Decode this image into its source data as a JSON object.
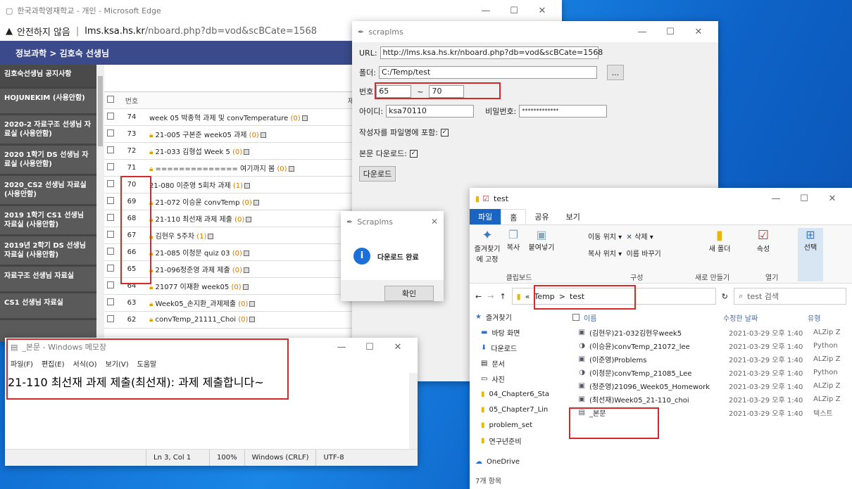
{
  "edge": {
    "title": "한국과학영재학교 - 개인 - Microsoft Edge",
    "warning": "안전하지 않음",
    "host": "lms.ksa.hs.kr",
    "path": "/nboard.php?db=vod&scBCate=1568",
    "site_header": "정보과학 > 김호숙 선생님",
    "sidebar": [
      "김호숙선생님 공지사항",
      "HOJUNEKIM (사용안함)",
      "2020-2 자료구조 선생님 자료실 (사용안함)",
      "2020 1학기 DS 선생님 자료실 (사용안함)",
      "2020_CS2 선생님 자료실 (사용안함)",
      "2019 1학기 CS1 선생님 자료실 (사용안함)",
      "2019년 2학기 DS 선생님자료실 (사용안함)",
      "자료구조 선생님 자료실",
      "CS1 선생님 자료실"
    ],
    "columns": {
      "num": "번호",
      "title": "제목"
    },
    "rows": [
      {
        "num": "74",
        "lock": false,
        "title": "week 05 박종혁 과제 및 convTemperature",
        "count": "(0)"
      },
      {
        "num": "73",
        "lock": true,
        "title": "21-005 구본준 week05 과제",
        "count": "(0)"
      },
      {
        "num": "72",
        "lock": true,
        "title": "21-033 김형섭 Week 5",
        "count": "(0)"
      },
      {
        "num": "71",
        "lock": true,
        "title": "============== 여기까지 봄",
        "count": "(0)"
      },
      {
        "num": "70",
        "lock": false,
        "title": "21-080 이준영 5회차 과제",
        "count": "(1)"
      },
      {
        "num": "69",
        "lock": true,
        "title": "21-072 이승윤 convTemp",
        "count": "(0)"
      },
      {
        "num": "68",
        "lock": true,
        "title": "21-110 최선재 과제 제출",
        "count": "(0)"
      },
      {
        "num": "67",
        "lock": true,
        "title": "김현우 5주차",
        "count": "(1)"
      },
      {
        "num": "66",
        "lock": true,
        "title": "21-085 이청문 quiz 03",
        "count": "(0)"
      },
      {
        "num": "65",
        "lock": true,
        "title": "21-096정준영 과제 제출",
        "count": "(0)"
      },
      {
        "num": "64",
        "lock": true,
        "title": "21077 이재환 week05",
        "count": "(0)"
      },
      {
        "num": "63",
        "lock": true,
        "title": "Week05_손지환_과제제출",
        "count": "(0)"
      },
      {
        "num": "62",
        "lock": true,
        "title": "convTemp_21111_Choi",
        "count": "(0)"
      }
    ]
  },
  "scrap": {
    "title": "scraplms",
    "url_label": "URL:",
    "url": "http://lms.ksa.hs.kr/nboard.php?db=vod&scBCate=1568",
    "folder_label": "폴더:",
    "folder": "C:/Temp/test",
    "browse": "...",
    "num_label": "번호",
    "num_from": "65",
    "tilde": "~",
    "num_to": "70",
    "id_label": "아이디:",
    "id": "ksa70110",
    "pw_label": "비밀번호:",
    "pw": "*************",
    "author_label": "작성자를 파일명에 포함:",
    "body_label": "본문 다운로드:",
    "check": "✓",
    "download": "다운로드"
  },
  "dialog": {
    "title": "Scraplms",
    "message": "다운로드 완료",
    "ok": "확인"
  },
  "notepad": {
    "title": "_본문 - Windows 메모장",
    "menu": [
      "파일(F)",
      "편집(E)",
      "서식(O)",
      "보기(V)",
      "도움말"
    ],
    "content": "21-110 최선재 과제 제출(최선재): 과제 제출합니다~",
    "status": [
      "Ln 3, Col 1",
      "100%",
      "Windows (CRLF)",
      "UTF-8"
    ]
  },
  "explorer": {
    "title": "test",
    "tabs": [
      "파일",
      "홈",
      "공유",
      "보기"
    ],
    "ribbon": {
      "pin": "즐겨찾기에 고정",
      "copy": "복사",
      "paste": "붙여넣기",
      "clipboard": "클립보드",
      "move": "이동 위치",
      "delete": "삭제",
      "copyto": "복사 위치",
      "rename": "이름 바꾸기",
      "organize": "구성",
      "newfolder": "새 폴더",
      "new": "새로 만들기",
      "props": "속성",
      "open": "열기",
      "select": "선택"
    },
    "crumb": [
      "«",
      "Temp",
      ">",
      "test"
    ],
    "search": "test 검색",
    "nav": [
      "즐겨찾기",
      "바탕 화면",
      "다운로드",
      "문서",
      "사진",
      "04_Chapter6_Sta",
      "05_Chapter7_Lin",
      "problem_set",
      "연구년준비",
      "OneDrive"
    ],
    "cols": {
      "name": "이름",
      "date": "수정한 날짜",
      "type": "유형"
    },
    "files": [
      {
        "name": "(김현우)21-032김현우week5",
        "date": "2021-03-29 오후 1:40",
        "type": "ALZip Z"
      },
      {
        "name": "(이승윤)convTemp_21072_lee",
        "date": "2021-03-29 오후 1:40",
        "type": "Python"
      },
      {
        "name": "(이준영)Problems",
        "date": "2021-03-29 오후 1:40",
        "type": "ALZip Z"
      },
      {
        "name": "(이청문)convTemp_21085_Lee",
        "date": "2021-03-29 오후 1:40",
        "type": "Python"
      },
      {
        "name": "(정준영)21096_Week05_Homework",
        "date": "2021-03-29 오후 1:40",
        "type": "ALZip Z"
      },
      {
        "name": "(최선재)Week05_21-110_choi",
        "date": "2021-03-29 오후 1:40",
        "type": "ALZip Z"
      },
      {
        "name": "_본문",
        "date": "2021-03-29 오후 1:40",
        "type": "텍스트"
      }
    ],
    "status": "7개 항목"
  }
}
